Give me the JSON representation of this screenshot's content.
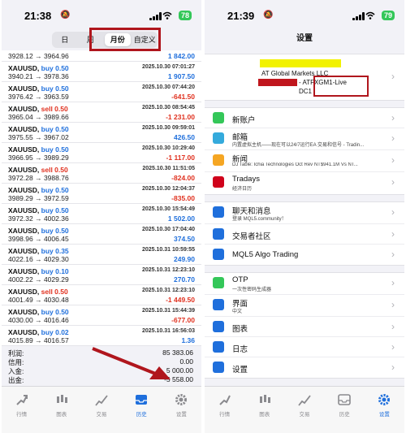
{
  "left": {
    "status": {
      "time": "21:38",
      "battery": "78"
    },
    "segments": [
      "日",
      "周",
      "月份",
      "自定义"
    ],
    "active_segment": 2,
    "top_row": {
      "prices": "3928.12 → 3964.96",
      "profit": "1 842.00"
    },
    "deals": [
      {
        "symbol": "XAUUSD,",
        "side": "buy 0.50",
        "prices": "3940.21 → 3978.36",
        "date": "2025.10.30 07:01:27",
        "profit": "1 907.50",
        "positive": true
      },
      {
        "symbol": "XAUUSD,",
        "side": "buy 0.50",
        "prices": "3976.42 → 3963.59",
        "date": "2025.10.30 07:44:20",
        "profit": "-641.50",
        "positive": false
      },
      {
        "symbol": "XAUUSD,",
        "side": "sell 0.50",
        "prices": "3965.04 → 3989.66",
        "date": "2025.10.30 08:54:45",
        "profit": "-1 231.00",
        "positive": false
      },
      {
        "symbol": "XAUUSD,",
        "side": "buy 0.50",
        "prices": "3975.55 → 3967.02",
        "date": "2025.10.30 09:59:01",
        "profit": "426.50",
        "positive": true
      },
      {
        "symbol": "XAUUSD,",
        "side": "buy 0.50",
        "prices": "3966.95 → 3989.29",
        "date": "2025.10.30 10:29:40",
        "profit": "-1 117.00",
        "positive": false
      },
      {
        "symbol": "XAUUSD,",
        "side": "sell 0.50",
        "prices": "3972.28 → 3988.76",
        "date": "2025.10.30 11:51:05",
        "profit": "-824.00",
        "positive": false
      },
      {
        "symbol": "XAUUSD,",
        "side": "buy 0.50",
        "prices": "3989.29 → 3972.59",
        "date": "2025.10.30 12:04:37",
        "profit": "-835.00",
        "positive": false
      },
      {
        "symbol": "XAUUSD,",
        "side": "buy 0.50",
        "prices": "3972.32 → 4002.36",
        "date": "2025.10.30 15:54:49",
        "profit": "1 502.00",
        "positive": true
      },
      {
        "symbol": "XAUUSD,",
        "side": "buy 0.50",
        "prices": "3998.96 → 4006.45",
        "date": "2025.10.30 17:04:40",
        "profit": "374.50",
        "positive": true
      },
      {
        "symbol": "XAUUSD,",
        "side": "buy 0.35",
        "prices": "4022.16 → 4029.30",
        "date": "2025.10.31 10:59:55",
        "profit": "249.90",
        "positive": true
      },
      {
        "symbol": "XAUUSD,",
        "side": "buy 0.10",
        "prices": "4002.22 → 4029.29",
        "date": "2025.10.31 12:23:10",
        "profit": "270.70",
        "positive": true
      },
      {
        "symbol": "XAUUSD,",
        "side": "sell 0.50",
        "prices": "4001.49 → 4030.48",
        "date": "2025.10.31 12:23:10",
        "profit": "-1 449.50",
        "positive": false
      },
      {
        "symbol": "XAUUSD,",
        "side": "buy 0.50",
        "prices": "4030.00 → 4016.46",
        "date": "2025.10.31 15:44:39",
        "profit": "-677.00",
        "positive": false
      },
      {
        "symbol": "XAUUSD,",
        "side": "buy 0.02",
        "prices": "4015.89 → 4016.57",
        "date": "2025.10.31 16:56:03",
        "profit": "1.36",
        "positive": true
      }
    ],
    "summary": [
      {
        "label": "利润:",
        "value": "85 383.06"
      },
      {
        "label": "信用:",
        "value": "0.00"
      },
      {
        "label": "入金:",
        "value": "5 000.00"
      },
      {
        "label": "出金:",
        "value": "-5 558.00"
      }
    ],
    "tabs": [
      "行情",
      "图表",
      "交易",
      "历史",
      "设置"
    ],
    "active_tab": 3
  },
  "right": {
    "status": {
      "time": "21:39",
      "battery": "79"
    },
    "title": "设置",
    "account": {
      "company": "AT Global Markets LLC",
      "server": "- ATFXGM1-Live",
      "platform": "DC1"
    },
    "group1": [
      {
        "title": "新账户",
        "subtitle": "",
        "icon": "person-plus-icon",
        "color": "#34c759"
      },
      {
        "title": "邮箱",
        "subtitle": "内置虚拟主机——现在可以24/7运行EA 交易和信号 - Tradin...",
        "icon": "mail-icon",
        "color": "#34aadc"
      },
      {
        "title": "新闻",
        "subtitle": "DJ Table: Ichia Technologies Oct Rev NT$941.1M Vs NT...",
        "icon": "news-icon",
        "color": "#f5a623"
      },
      {
        "title": "Tradays",
        "subtitle": "经济日历",
        "icon": "calendar-icon",
        "color": "#d0021b"
      }
    ],
    "group2": [
      {
        "title": "聊天和消息",
        "subtitle": "登录 MQL5.community！",
        "icon": "chat-icon",
        "color": "#1f6fdc"
      },
      {
        "title": "交易者社区",
        "subtitle": "",
        "icon": "mql5-icon",
        "color": "#1f6fdc"
      },
      {
        "title": "MQL5 Algo Trading",
        "subtitle": "",
        "icon": "algo-icon",
        "color": "#1f6fdc"
      }
    ],
    "group3": [
      {
        "title": "OTP",
        "subtitle": "一次性密码生成器",
        "icon": "otp-icon",
        "color": "#34c759"
      },
      {
        "title": "界面",
        "subtitle": "中文",
        "icon": "language-icon",
        "color": "#1f6fdc"
      },
      {
        "title": "图表",
        "subtitle": "",
        "icon": "chart-icon",
        "color": "#1f6fdc"
      },
      {
        "title": "日志",
        "subtitle": "",
        "icon": "journal-icon",
        "color": "#1f6fdc"
      },
      {
        "title": "设置",
        "subtitle": "",
        "icon": "settings-icon",
        "color": "#1f6fdc"
      }
    ],
    "tabs": [
      "行情",
      "图表",
      "交易",
      "历史",
      "设置"
    ],
    "active_tab": 4
  },
  "colors": {
    "accent": "#1f6fdc",
    "loss": "#e0301e",
    "annotation": "#b0161d"
  }
}
